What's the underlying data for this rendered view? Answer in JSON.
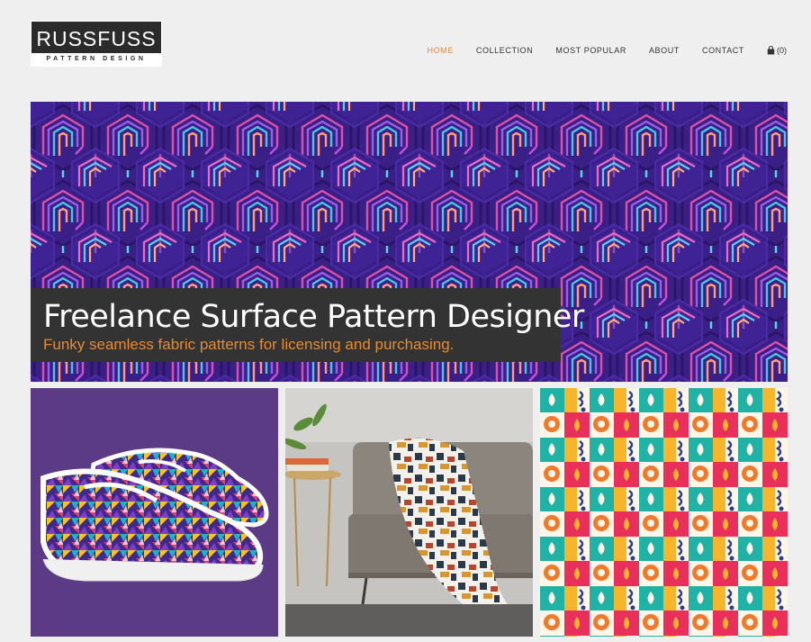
{
  "brand": {
    "name": "RUSSFUSS",
    "tagline": "PATTERN DESIGN"
  },
  "nav": {
    "items": [
      {
        "label": "HOME",
        "active": true
      },
      {
        "label": "COLLECTION",
        "active": false
      },
      {
        "label": "MOST POPULAR",
        "active": false
      },
      {
        "label": "ABOUT",
        "active": false
      },
      {
        "label": "CONTACT",
        "active": false
      }
    ],
    "cart": {
      "icon": "bag-icon",
      "count": "(0)"
    }
  },
  "hero": {
    "title": "Freelance Surface Pattern Designer",
    "subtitle": "Funky seamless fabric patterns for licensing and purchasing."
  },
  "colors": {
    "accent": "#e88a30",
    "caption_bg": "#333333",
    "page_bg": "#efefef"
  }
}
